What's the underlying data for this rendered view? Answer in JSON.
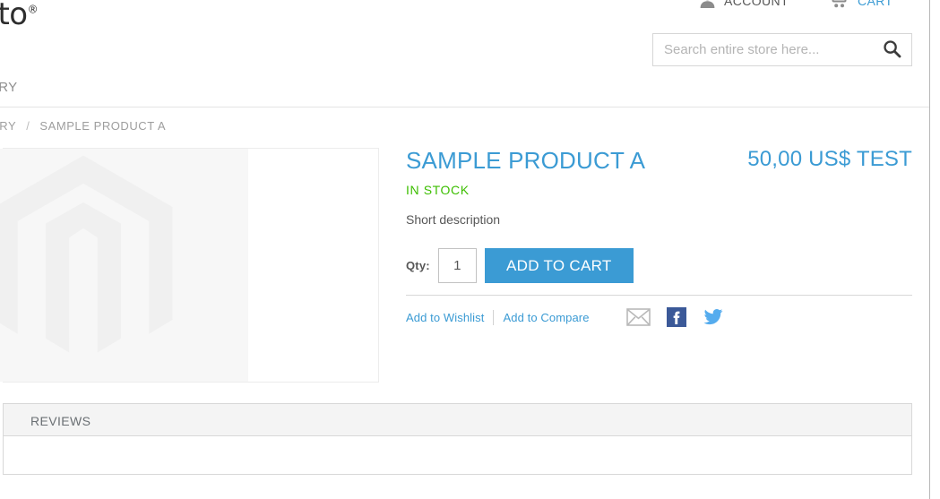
{
  "header": {
    "logo_text": "ento",
    "logo_mark": "®",
    "account_label": "ACCOUNT",
    "cart_label": "CART",
    "account_icon": "user-icon",
    "cart_icon": "shopping-cart-icon"
  },
  "search": {
    "placeholder": "Search entire store here...",
    "value": "",
    "icon": "search-icon"
  },
  "nav": {
    "items": [
      {
        "label": "EGORY"
      }
    ]
  },
  "breadcrumb": {
    "items": [
      {
        "label": "ATEGORY"
      },
      {
        "label": "SAMPLE PRODUCT A"
      }
    ],
    "separator": "/"
  },
  "gallery": {
    "placeholder_icon": "magento-logo-placeholder"
  },
  "product": {
    "title": "SAMPLE PRODUCT A",
    "price": "50,00 US$ TEST",
    "stock_status": "IN STOCK",
    "short_description": "Short description",
    "qty_label": "Qty:",
    "qty_value": "1",
    "add_to_cart_label": "ADD TO CART",
    "wishlist_label": "Add to Wishlist",
    "compare_label": "Add to Compare",
    "social": [
      {
        "name": "email-share-icon"
      },
      {
        "name": "facebook-share-icon"
      },
      {
        "name": "twitter-share-icon"
      }
    ]
  },
  "tabs": {
    "items": [
      {
        "label": "REVIEWS"
      }
    ]
  },
  "colors": {
    "accent_blue": "#3b9bd4",
    "stock_green": "#3cbe00",
    "facebook_blue": "#3b5998",
    "twitter_blue": "#55acee",
    "text_grey": "#575757",
    "muted_grey": "#9d9d9d"
  }
}
